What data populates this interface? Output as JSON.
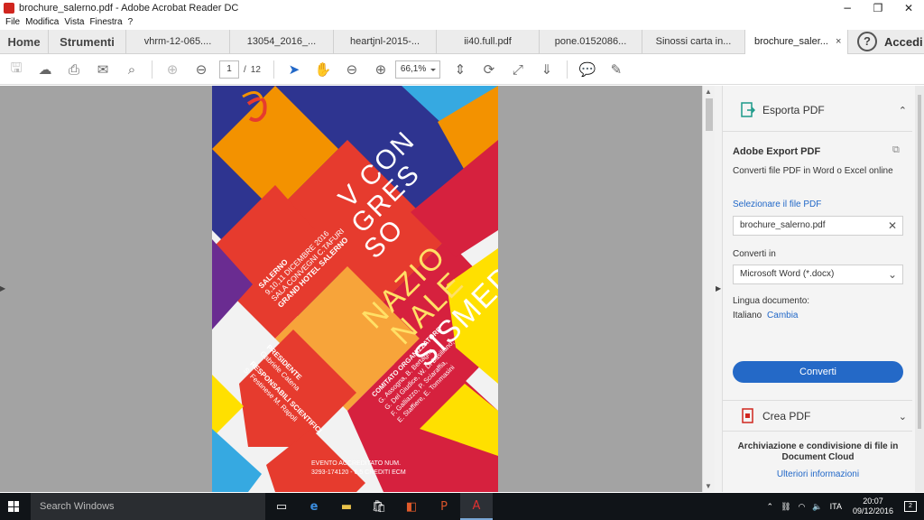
{
  "window": {
    "title": "brochure_salerno.pdf - Adobe Acrobat Reader DC"
  },
  "menu": [
    "File",
    "Modifica",
    "Vista",
    "Finestra",
    "?"
  ],
  "tabs": {
    "home": "Home",
    "tools": "Strumenti",
    "docs": [
      "vhrm-12-065....",
      "13054_2016_...",
      "heartjnl-2015-...",
      "ii40.full.pdf",
      "pone.0152086...",
      "Sinossi carta in..."
    ],
    "active_doc": "brochure_saler...",
    "close": "×",
    "help": "?",
    "login": "Accedi"
  },
  "toolbar": {
    "page_current": "1",
    "page_sep": "/",
    "page_total": "12",
    "zoom": "66,1%"
  },
  "pdf": {
    "title_lines": [
      "V CON",
      "GRES",
      "SO",
      "NAZIO",
      "NALE",
      "SISMED"
    ],
    "location": [
      "SALERNO",
      "9,10,11 DICEMBRE 2016",
      "SALA CONVEGNI C.TAFURI",
      "GRAND HOTEL SALERNO"
    ],
    "president_label": "PRESIDENTE",
    "president_name": "Gabriele Catena",
    "scientific_label": "RESPONSABILI SCIENTIFICI",
    "scientific_names": "S. Festinese  M. Rapoli",
    "committee_label": "COMITATO ORGANIZZATORE",
    "committee_lines": [
      "G. Assogna, B. Bertagna,",
      "G. Del Giudice, W. Di Basiliano,",
      "F. Galliazzo, P. Sciaraffia,",
      "E. Staffiere, E. Tommasini"
    ],
    "accreditation": [
      "EVENTO ACCREDITATO NUM.",
      "3293-174120 - 6,5 CREDITI ECM"
    ]
  },
  "right_panel": {
    "export_header": "Esporta PDF",
    "adobe_export_title": "Adobe Export PDF",
    "adobe_export_desc": "Converti file PDF in Word o Excel online",
    "select_label": "Selezionare il file PDF",
    "file_name": "brochure_salerno.pdf",
    "convert_to_label": "Converti in",
    "format": "Microsoft Word (*.docx)",
    "lang_label": "Lingua documento:",
    "lang_value": "Italiano",
    "lang_change": "Cambia",
    "convert_button": "Converti",
    "create_header": "Crea PDF",
    "cloud_text": "Archiviazione e condivisione di file in Document Cloud",
    "more_info": "Ulteriori informazioni"
  },
  "taskbar": {
    "search_placeholder": "Search Windows",
    "lang": "ITA",
    "time": "20:07",
    "date": "09/12/2016",
    "notifications": "2"
  },
  "colors": {
    "accent_blue": "#2469c7",
    "acrobat_red": "#d0261f",
    "poster_navy": "#2e3490",
    "poster_red": "#e63b2e",
    "poster_orange": "#f39200",
    "poster_yellow": "#ffe000",
    "poster_purple": "#6a2c91",
    "poster_light_blue": "#36a9e1",
    "poster_crimson": "#d6213e"
  }
}
